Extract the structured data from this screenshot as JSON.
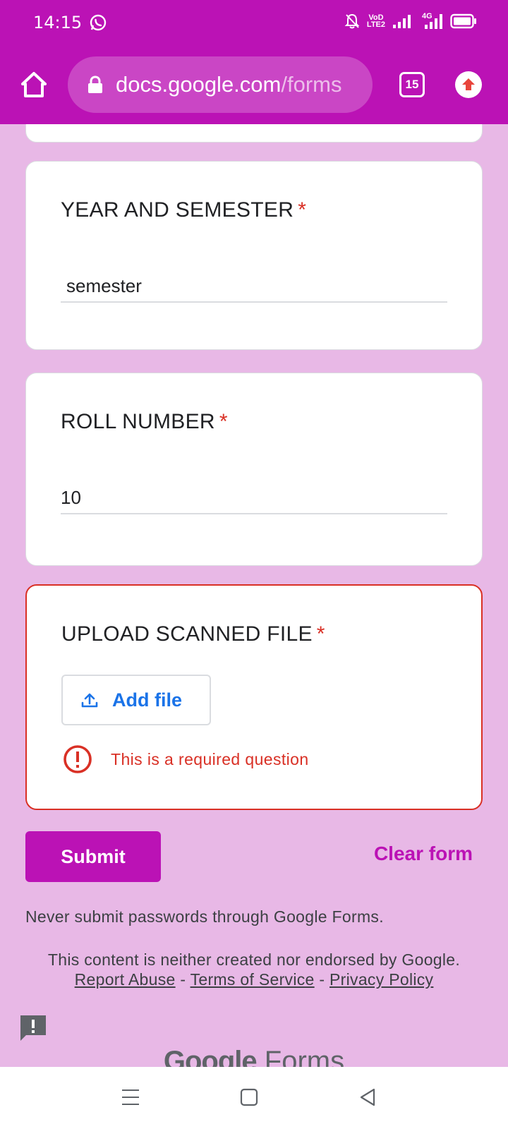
{
  "status_bar": {
    "time": "14:15",
    "icons": [
      "whatsapp-icon",
      "mute-icon",
      "volte-icon",
      "signal-icon",
      "4g-signal-icon",
      "battery-icon"
    ],
    "volte_label_top": "VoD",
    "volte_label_bottom": "LTE2",
    "network": "4G"
  },
  "browser": {
    "url_domain": "docs.google.com",
    "url_path": "/forms",
    "tab_count": "15",
    "accent_color": "#bb12b5"
  },
  "form": {
    "questions": [
      {
        "title": "YEAR AND SEMESTER",
        "required_mark": "*",
        "value": "semester"
      },
      {
        "title": "ROLL NUMBER",
        "required_mark": "*",
        "value": "10"
      },
      {
        "title": "UPLOAD SCANNED FILE",
        "required_mark": "*",
        "button_label": "Add file",
        "error": "This is a required question"
      }
    ],
    "submit_label": "Submit",
    "clear_label": "Clear form"
  },
  "footer": {
    "password_note": "Never submit passwords through Google Forms.",
    "disclaimer": "This content is neither created nor endorsed by Google.",
    "report_abuse": "Report Abuse",
    "separator": "-",
    "terms": "Terms of Service",
    "privacy": "Privacy Policy",
    "logo_google": "Google",
    "logo_forms": "Forms"
  }
}
